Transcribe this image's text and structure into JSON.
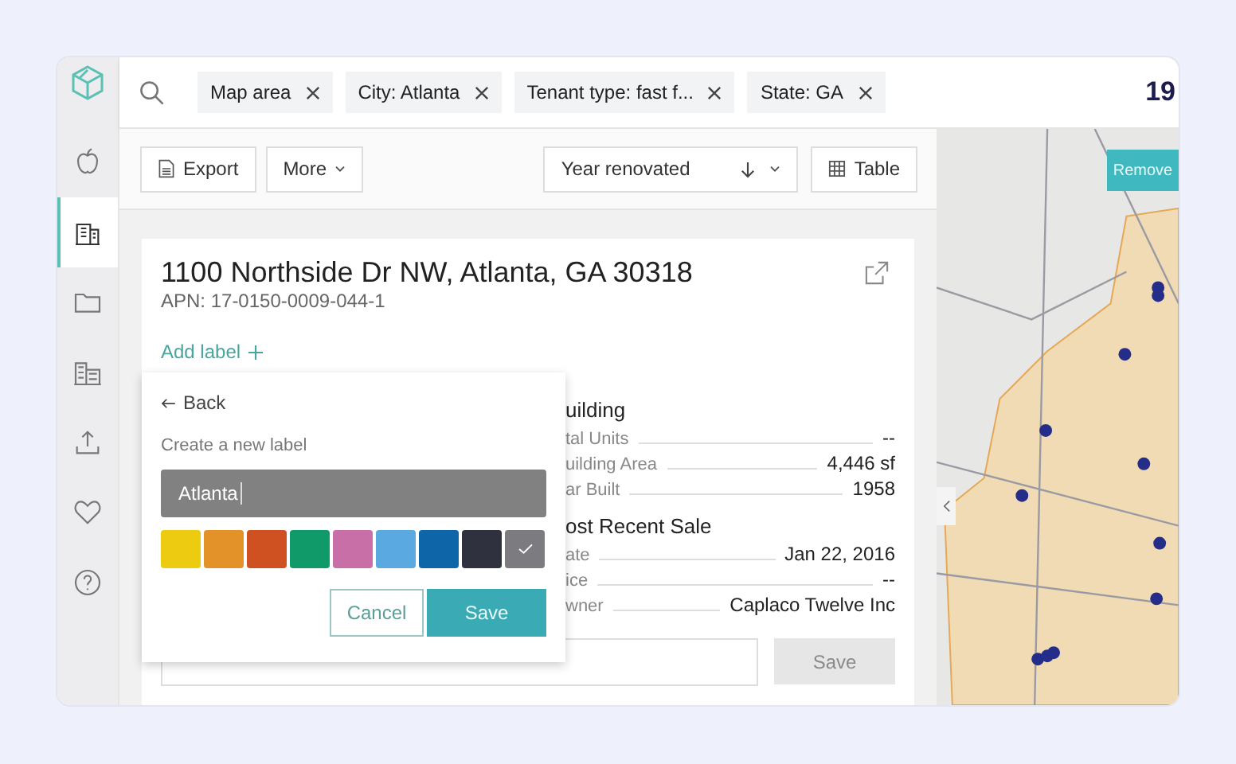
{
  "sidebar": {
    "items": [
      {
        "selected": false
      },
      {
        "selected": true
      },
      {
        "selected": false
      },
      {
        "selected": false
      },
      {
        "selected": false
      },
      {
        "selected": false
      },
      {
        "selected": false
      }
    ]
  },
  "filters": [
    {
      "label": "Map area"
    },
    {
      "label": "City: Atlanta"
    },
    {
      "label": "Tenant type: fast f..."
    },
    {
      "label": "State: GA"
    }
  ],
  "result_count": "19",
  "toolbar": {
    "export": "Export",
    "more": "More",
    "sort": "Year renovated",
    "view": "Table"
  },
  "property": {
    "address": "1100 Northside Dr NW, Atlanta, GA 30318",
    "apn": "APN: 17-0150-0009-044-1",
    "add_label": "Add label",
    "sections": [
      {
        "heading": "uilding",
        "rows": [
          {
            "label": "tal Units",
            "value": "--"
          },
          {
            "label": "uilding Area",
            "value": "4,446 sf"
          },
          {
            "label": "ar Built",
            "value": "1958"
          }
        ]
      },
      {
        "heading": "ost Recent Sale",
        "rows": [
          {
            "label": "ate",
            "value": "Jan 22, 2016"
          },
          {
            "label": "ice",
            "value": "--"
          },
          {
            "label": "wner",
            "value": "Caplaco Twelve Inc"
          }
        ]
      }
    ],
    "note_save": "Save"
  },
  "label_popup": {
    "back": "Back",
    "title": "Create a new label",
    "value": "Atlanta",
    "swatches": [
      {
        "color": "#eccb10",
        "selected": false
      },
      {
        "color": "#e3922a",
        "selected": false
      },
      {
        "color": "#cf5121",
        "selected": false
      },
      {
        "color": "#109a69",
        "selected": false
      },
      {
        "color": "#c86fa7",
        "selected": false
      },
      {
        "color": "#5aa9e0",
        "selected": false
      },
      {
        "color": "#0e66a8",
        "selected": false
      },
      {
        "color": "#30313f",
        "selected": false
      },
      {
        "color": "#7c7c80",
        "selected": true
      }
    ],
    "cancel": "Cancel",
    "save": "Save"
  },
  "map": {
    "remove_button": "Remove"
  }
}
